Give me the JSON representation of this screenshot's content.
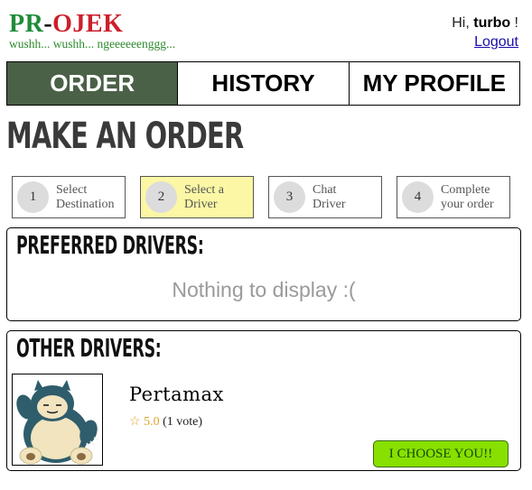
{
  "header": {
    "logo_pr": "PR",
    "logo_dash": "-",
    "logo_ojek": "OJEK",
    "tagline": "wushh... wushh... ngeeeeeenggg...",
    "greeting_prefix": "Hi, ",
    "username": "turbo",
    "greeting_suffix": " !",
    "logout_label": "Logout"
  },
  "tabs": [
    {
      "label": "ORDER",
      "active": true
    },
    {
      "label": "HISTORY",
      "active": false
    },
    {
      "label": "MY PROFILE",
      "active": false
    }
  ],
  "page_title": "MAKE AN ORDER",
  "steps": [
    {
      "num": "1",
      "line1": "Select",
      "line2": "Destination",
      "active": false
    },
    {
      "num": "2",
      "line1": "Select a",
      "line2": "Driver",
      "active": true
    },
    {
      "num": "3",
      "line1": "Chat",
      "line2": "Driver",
      "active": false
    },
    {
      "num": "4",
      "line1": "Complete",
      "line2": "your order",
      "active": false
    }
  ],
  "preferred": {
    "title": "PREFERRED DRIVERS:",
    "empty_message": "Nothing to display :("
  },
  "other": {
    "title": "OTHER DRIVERS:",
    "drivers": [
      {
        "name": "Pertamax",
        "star": "☆",
        "rating": "5.0",
        "votes": "(1 vote)",
        "button_label": "I CHOOSE YOU!!"
      }
    ]
  },
  "colors": {
    "active_tab": "#4b6147",
    "active_step": "#fbf7a5",
    "choose_button": "#87e000",
    "logo_pr": "#1e8c3a",
    "logo_ojek": "#cc1f2b"
  },
  "icons": {
    "avatar": "snorlax-avatar-image",
    "rating": "star-icon"
  }
}
